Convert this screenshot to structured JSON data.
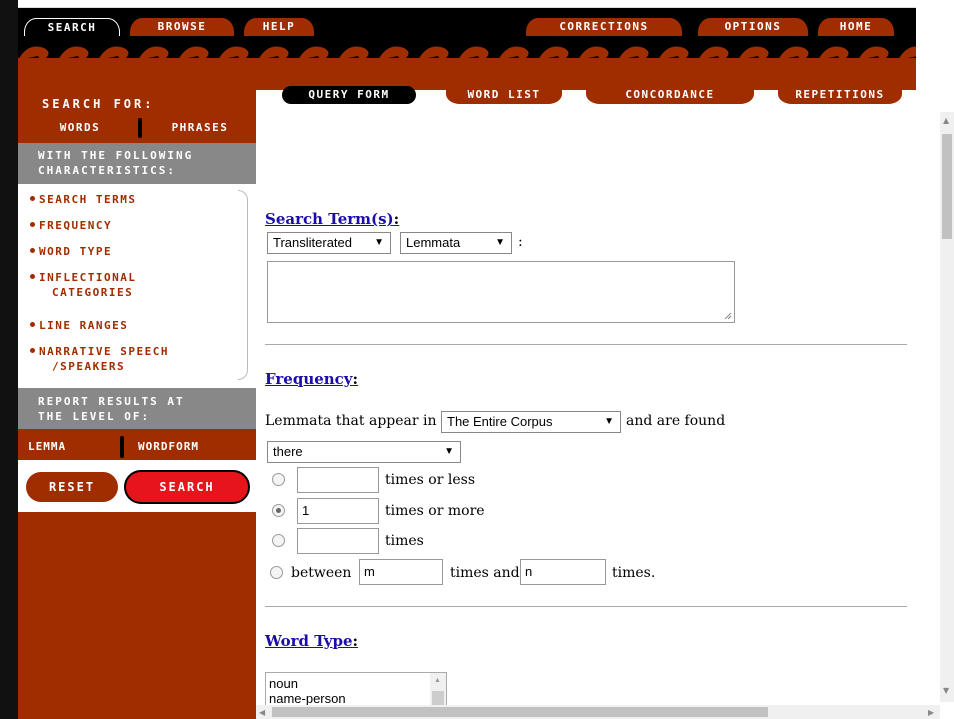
{
  "top_nav": {
    "search": "SEARCH",
    "browse": "BROWSE",
    "help": "HELP",
    "corrections": "CORRECTIONS",
    "options": "OPTIONS",
    "home": "HOME"
  },
  "sub_tabs": {
    "query_form": "QUERY FORM",
    "word_list": "WORD LIST",
    "concordance": "CONCORDANCE",
    "repetitions": "REPETITIONS"
  },
  "sidebar": {
    "search_for": "SEARCH FOR:",
    "words": "WORDS",
    "phrases": "PHRASES",
    "characteristics_header_1": "WITH THE FOLLOWING",
    "characteristics_header_2": "CHARACTERISTICS:",
    "characteristics": {
      "search_terms": "SEARCH TERMS",
      "frequency": "FREQUENCY",
      "word_type": "WORD TYPE",
      "inflectional_1": "INFLECTIONAL",
      "inflectional_2": "CATEGORIES",
      "line_ranges": "LINE RANGES",
      "narrative_1": "NARRATIVE SPEECH",
      "narrative_2": "/SPEAKERS"
    },
    "report_header_1": "REPORT RESULTS AT",
    "report_header_2": "THE LEVEL OF:",
    "lemma": "LEMMA",
    "wordform": "WORDFORM",
    "reset": "RESET",
    "search": "SEARCH"
  },
  "search_terms": {
    "heading": "Search Term(s)",
    "colon": ":",
    "script_select": "Transliterated",
    "form_select": "Lemmata",
    "after_selects": ":"
  },
  "frequency": {
    "heading": "Frequency",
    "colon": ":",
    "prefix": "Lemmata that appear in",
    "corpus_select": "The Entire Corpus",
    "suffix": "and are found",
    "where_select": "there",
    "opt_less_value": "",
    "opt_less_label": "times or less",
    "opt_more_value": "1",
    "opt_more_label": "times or more",
    "opt_exact_value": "",
    "opt_exact_label": "times",
    "between_label": "between",
    "between_m": "m",
    "times_and": "times and",
    "between_n": "n",
    "times_end": "times."
  },
  "word_type": {
    "heading": "Word Type",
    "colon": ":",
    "options": [
      "noun",
      "name-person"
    ]
  },
  "colors": {
    "brown": "#a02d00",
    "red": "#e8141b",
    "gray": "#888888",
    "link": "#1a0dab"
  }
}
